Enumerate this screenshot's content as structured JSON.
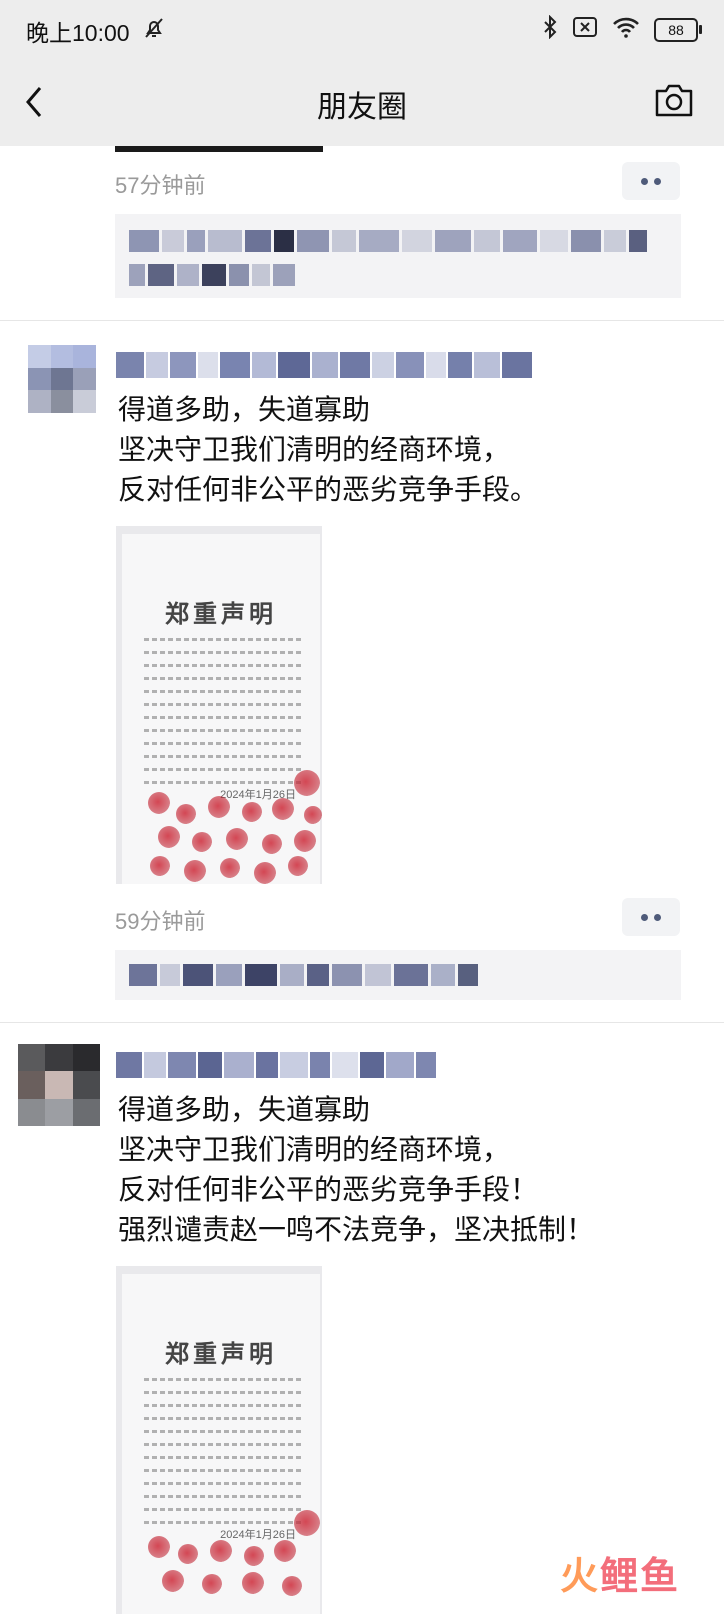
{
  "status_bar": {
    "time": "晚上10:00",
    "battery": "88"
  },
  "nav": {
    "title": "朋友圈"
  },
  "posts": [
    {
      "time": "57分钟前"
    },
    {
      "lines": [
        "得道多助，失道寡助",
        "坚决守卫我们清明的经商环境，",
        "反对任何非公平的恶劣竞争手段。"
      ],
      "image": {
        "title": "郑重声明",
        "date": "2024年1月26日"
      },
      "time": "59分钟前"
    },
    {
      "lines": [
        "得道多助，失道寡助",
        "坚决守卫我们清明的经商环境，",
        "反对任何非公平的恶劣竞争手段！",
        "强烈谴责赵一鸣不法竞争，坚决抵制！"
      ],
      "image": {
        "title": "郑重声明",
        "date": "2024年1月26日"
      }
    }
  ],
  "watermark": {
    "part1": "火",
    "part2": "鲤鱼"
  },
  "icons": [
    "mute-icon",
    "bluetooth-icon",
    "sim-off-icon",
    "wifi-icon",
    "battery-icon",
    "back-icon",
    "camera-icon",
    "more-icon"
  ]
}
